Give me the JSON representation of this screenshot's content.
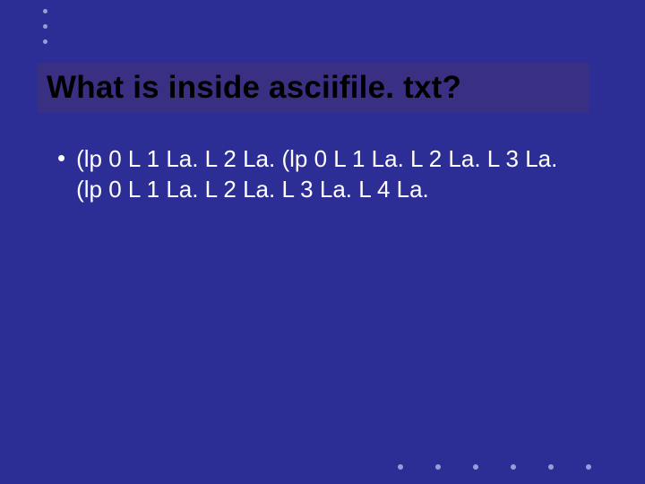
{
  "slide": {
    "title": "What is inside asciifile. txt?",
    "bullets": [
      {
        "text": "(lp 0 L 1 La. L 2 La. (lp 0 L 1 La. L 2 La. L 3 La. (lp 0 L 1 La. L 2 La. L 3 La. L 4 La."
      }
    ]
  },
  "decor": {
    "top_dot_count": 3,
    "bottom_dot_count": 6
  }
}
